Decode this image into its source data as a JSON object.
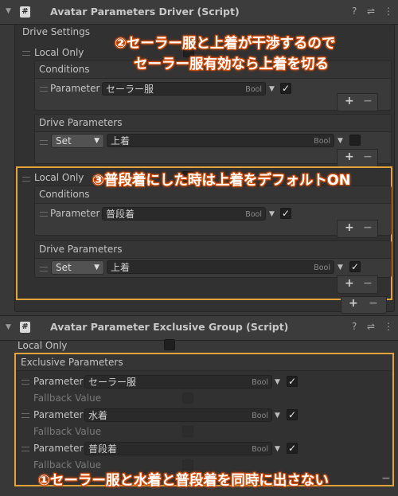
{
  "driver": {
    "title": "Avatar Parameters Driver (Script)",
    "drive_settings_label": "Drive Settings",
    "entries": [
      {
        "local_only_label": "Local Only",
        "conditions_label": "Conditions",
        "condition": {
          "label": "Parameter",
          "value": "セーラー服",
          "type": "Bool",
          "checked": true
        },
        "drive_parameters_label": "Drive Parameters",
        "drive": {
          "mode": "Set",
          "value": "上着",
          "type": "Bool",
          "checked": false
        }
      },
      {
        "local_only_label": "Local Only",
        "conditions_label": "Conditions",
        "condition": {
          "label": "Parameter",
          "value": "普段着",
          "type": "Bool",
          "checked": true
        },
        "drive_parameters_label": "Drive Parameters",
        "drive": {
          "mode": "Set",
          "value": "上着",
          "type": "Bool",
          "checked": true
        }
      }
    ]
  },
  "group": {
    "title": "Avatar Parameter Exclusive Group (Script)",
    "local_only_label": "Local Only",
    "exclusive_label": "Exclusive Parameters",
    "params": [
      {
        "label": "Parameter",
        "value": "セーラー服",
        "type": "Bool",
        "checked": true,
        "fallback_label": "Fallback Value"
      },
      {
        "label": "Parameter",
        "value": "水着",
        "type": "Bool",
        "checked": true,
        "fallback_label": "Fallback Value"
      },
      {
        "label": "Parameter",
        "value": "普段着",
        "type": "Bool",
        "checked": true,
        "fallback_label": "Fallback Value"
      }
    ]
  },
  "annotations": {
    "note2_line1": "②セーラー服と上着が干渉するので",
    "note2_line2": "セーラー服有効なら上着を切る",
    "note3": "③普段着にした時は上着をデフォルトON",
    "note1": "①セーラー服と水着と普段着を同時に出さない"
  },
  "icons": {
    "help": "?",
    "settings": "⇌",
    "more": "⋮",
    "script": "#",
    "plus": "+",
    "minus": "−",
    "check": "✓",
    "dropdown": "▼",
    "foldout": "▼"
  },
  "colors": {
    "highlight_border": "#e2a33b",
    "note_outline": "#d44f0c"
  }
}
